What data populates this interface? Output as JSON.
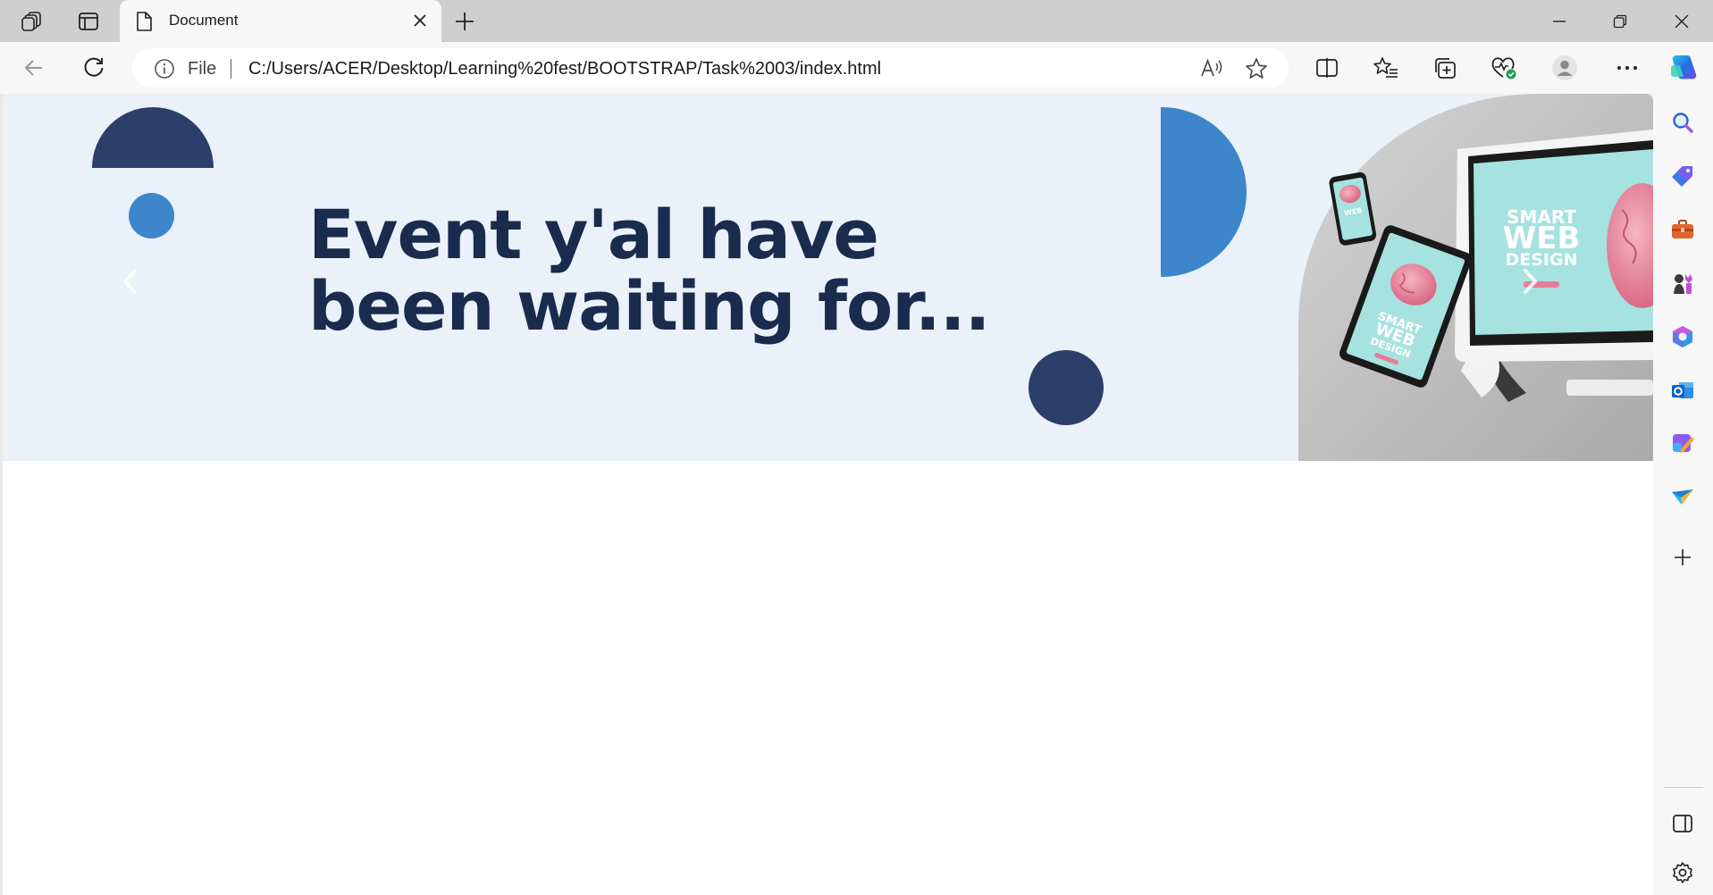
{
  "browser": {
    "tab_title": "Document",
    "address": {
      "scheme_label": "File",
      "url": "C:/Users/ACER/Desktop/Learning%20fest/BOOTSTRAP/Task%2003/index.html"
    },
    "icons": {
      "workspaces": "workspaces-icon",
      "tab_actions": "tab-actions-icon",
      "back": "back-arrow-icon",
      "refresh": "refresh-icon",
      "read_aloud": "read-aloud-icon",
      "favorite": "star-icon",
      "split_screen": "split-screen-icon",
      "favorites": "favorites-icon",
      "collections": "collections-icon",
      "performance": "performance-heart-icon",
      "profile": "profile-icon",
      "more": "more-icon",
      "copilot": "copilot-icon"
    },
    "sidebar_icons": [
      "search-icon",
      "shopping-tag-icon",
      "tools-briefcase-icon",
      "games-icon",
      "microsoft-365-icon",
      "outlook-icon",
      "designer-icon",
      "send-icon",
      "add-icon",
      "sidebar-toggle-icon",
      "settings-icon"
    ]
  },
  "page": {
    "hero": {
      "heading_line1": "Event y'al have",
      "heading_line2": "been waiting for...",
      "device_text_line1": "SMART",
      "device_text_line2": "WEB",
      "device_text_line3": "DESIGN"
    },
    "colors": {
      "hero_bg": "#eaf1f8",
      "navy": "#2c3f6b",
      "blue": "#3d86cb",
      "heading": "#1a2b4e"
    }
  }
}
